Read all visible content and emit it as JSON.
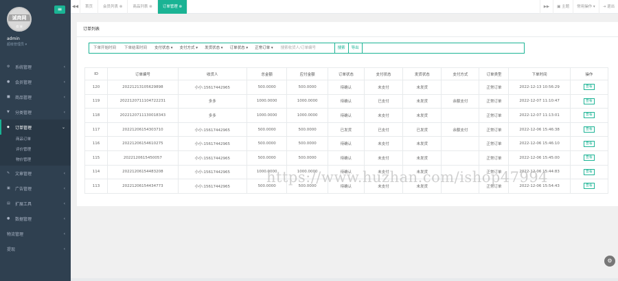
{
  "sidebar": {
    "avatar_text": "诚商网",
    "avatar_sub": "商 城",
    "user_name": "admin",
    "user_role": "超级管理员 ▾",
    "menu_toggle_icon": "menu-icon",
    "items": [
      {
        "label": "系统管理"
      },
      {
        "label": "会员管理"
      },
      {
        "label": "商品管理"
      },
      {
        "label": "分类管理"
      },
      {
        "label": "订单管理"
      },
      {
        "label": "文章管理"
      },
      {
        "label": "广告管理"
      },
      {
        "label": "扩展工具"
      },
      {
        "label": "数据管理"
      },
      {
        "label": "物流管理"
      },
      {
        "label": "提现"
      }
    ],
    "sub_items": [
      {
        "label": "商品订单"
      },
      {
        "label": "评价管理"
      },
      {
        "label": "物价管理"
      }
    ]
  },
  "topbar": {
    "tabs": [
      {
        "label": "首页"
      },
      {
        "label": "会员列表 ⊗"
      },
      {
        "label": "商品列表 ⊗"
      },
      {
        "label": "订单管理 ⊗"
      }
    ],
    "right": [
      "▶▶",
      "▣ 主题",
      "常用操作 ▾",
      "⇥ 退出"
    ],
    "back_arrow": "◀◀"
  },
  "panel": {
    "title": "订单列表"
  },
  "filter": {
    "start_placeholder": "下单开始时间",
    "end_placeholder": "下单结束时间",
    "selects": [
      "支付状态 ▾",
      "支付方式 ▾",
      "发货状态 ▾",
      "订单状态 ▾",
      "正常订单 ▾"
    ],
    "search_placeholder": "搜索收货人/订单编号",
    "search_button": "搜索",
    "export_button": "导出"
  },
  "table": {
    "headers": [
      "ID",
      "订单编号",
      "收货人",
      "总金额",
      "应付金额",
      "订单状态",
      "支付状态",
      "发货状态",
      "支付方式",
      "订单类型",
      "下单时间",
      "操作"
    ],
    "rows": [
      [
        "120",
        "20221213105629898",
        "小小:15617442965",
        "500.0000",
        "500.0000",
        "待确认",
        "未支付",
        "未发货",
        "",
        "正常订单",
        "2022-12-13 10:56:29",
        "查看"
      ],
      [
        "119",
        "2022120711104722231",
        "多多",
        "1000.0000",
        "1000.0000",
        "待确认",
        "已支付",
        "未发货",
        "余额支付",
        "正常订单",
        "2022-12-07 11:10:47",
        "查看"
      ],
      [
        "118",
        "2022120711130018343",
        "多多",
        "1000.0000",
        "1000.0000",
        "待确认",
        "未支付",
        "未发货",
        "",
        "正常订单",
        "2022-12-07 11:13:01",
        "查看"
      ],
      [
        "117",
        "20221206154303710",
        "小小:15617442965",
        "500.0000",
        "500.0000",
        "已发货",
        "已支付",
        "已发货",
        "余额支付",
        "正常订单",
        "2022-12-06 15:46:38",
        "查看"
      ],
      [
        "116",
        "20221206154610275",
        "小小:15617442965",
        "500.0000",
        "500.0000",
        "待确认",
        "未支付",
        "未发货",
        "",
        "正常订单",
        "2022-12-06 15:46:10",
        "查看"
      ],
      [
        "115",
        "2022120615450057",
        "小小:15617442965",
        "500.0000",
        "500.0000",
        "待确认",
        "未支付",
        "未发货",
        "",
        "正常订单",
        "2022-12-06 15:45:00",
        "查看"
      ],
      [
        "114",
        "20221206154483208",
        "小小:15617442965",
        "1000.0000",
        "1000.0000",
        "待确认",
        "未支付",
        "未发货",
        "",
        "正常订单",
        "2022-12-06 15:44:83",
        "查看"
      ],
      [
        "113",
        "20221206154434773",
        "小小:15617442965",
        "500.0000",
        "500.0000",
        "待确认",
        "未支付",
        "未发货",
        "",
        "正常订单",
        "2022-12-06 15:54:43",
        "查看"
      ]
    ]
  },
  "watermark": "https://www.huzhan.com/ishop47994",
  "colors": {
    "accent": "#1ab394",
    "sidebar": "#2f4050"
  }
}
